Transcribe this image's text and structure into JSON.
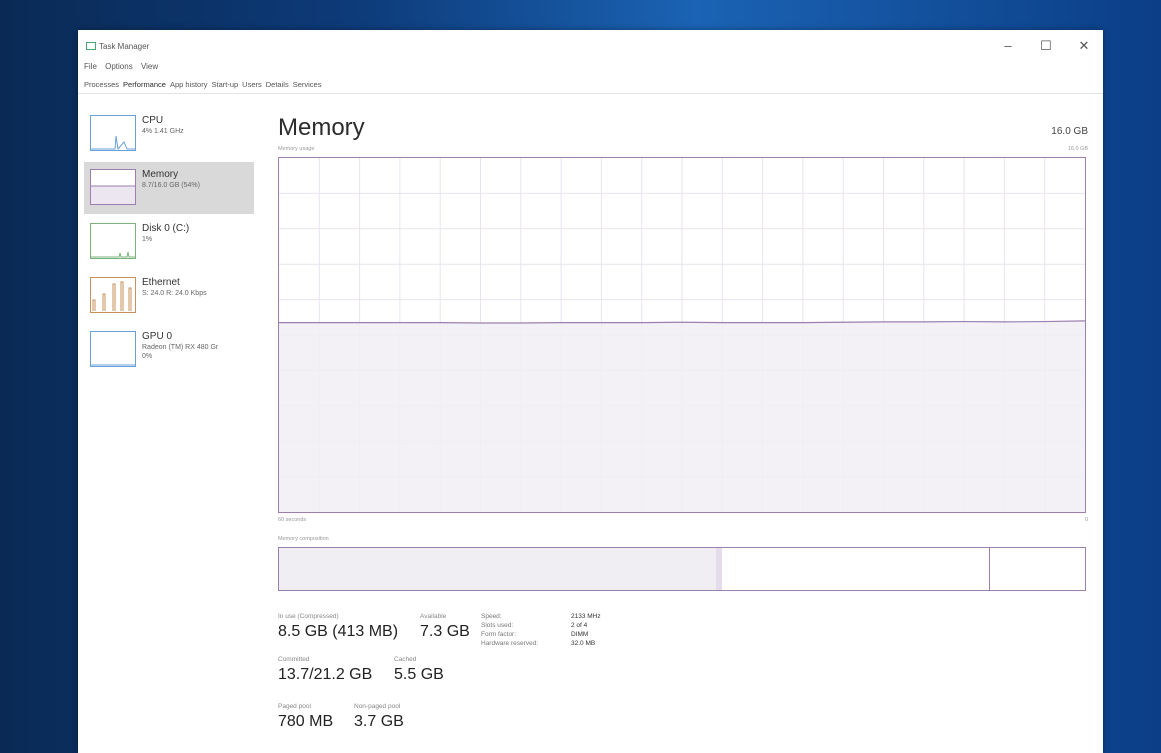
{
  "window": {
    "title": "Task Manager",
    "controls": {
      "minimize": "–",
      "maximize": "☐",
      "close": "✕"
    }
  },
  "menu": [
    "File",
    "Options",
    "View"
  ],
  "tabs": [
    "Processes",
    "Performance",
    "App history",
    "Start-up",
    "Users",
    "Details",
    "Services"
  ],
  "active_tab": "Performance",
  "sidebar": [
    {
      "name": "CPU",
      "sub": "4% 1.41 GHz",
      "sub2": ""
    },
    {
      "name": "Memory",
      "sub": "8.7/16.0 GB (54%)",
      "sub2": ""
    },
    {
      "name": "Disk 0 (C:)",
      "sub": "1%",
      "sub2": ""
    },
    {
      "name": "Ethernet",
      "sub": "S: 24.0  R: 24.0 Kbps",
      "sub2": ""
    },
    {
      "name": "GPU 0",
      "sub": "Radeon (TM) RX 480 Gr",
      "sub2": "0%"
    }
  ],
  "main": {
    "title": "Memory",
    "total": "16.0 GB",
    "graph_label": "Memory usage",
    "graph_max": "16.0 GB",
    "axis_left": "60 seconds",
    "axis_right": "0",
    "composition_label": "Memory composition"
  },
  "stats": {
    "in_use_label": "In use (Compressed)",
    "in_use_value": "8.5 GB (413 MB)",
    "available_label": "Available",
    "available_value": "7.3 GB",
    "committed_label": "Committed",
    "committed_value": "13.7/21.2 GB",
    "cached_label": "Cached",
    "cached_value": "5.5 GB",
    "paged_label": "Paged pool",
    "paged_value": "780 MB",
    "nonpaged_label": "Non-paged pool",
    "nonpaged_value": "3.7 GB"
  },
  "details": [
    {
      "key": "Speed:",
      "value": "2133 MHz"
    },
    {
      "key": "Slots used:",
      "value": "2 of 4"
    },
    {
      "key": "Form factor:",
      "value": "DIMM"
    },
    {
      "key": "Hardware reserved:",
      "value": "32.0 MB"
    }
  ],
  "usage_history_fraction": [
    0.535,
    0.535,
    0.535,
    0.535,
    0.535,
    0.534,
    0.534,
    0.535,
    0.535,
    0.535,
    0.536,
    0.535,
    0.535,
    0.535,
    0.536,
    0.537,
    0.537,
    0.538,
    0.537,
    0.538,
    0.54
  ],
  "colors": {
    "graph_line": "#9c7fb0",
    "graph_fill": "#f1eef3",
    "grid": "#e9e3ee",
    "sidebar_selected": "#d9d9d9"
  }
}
